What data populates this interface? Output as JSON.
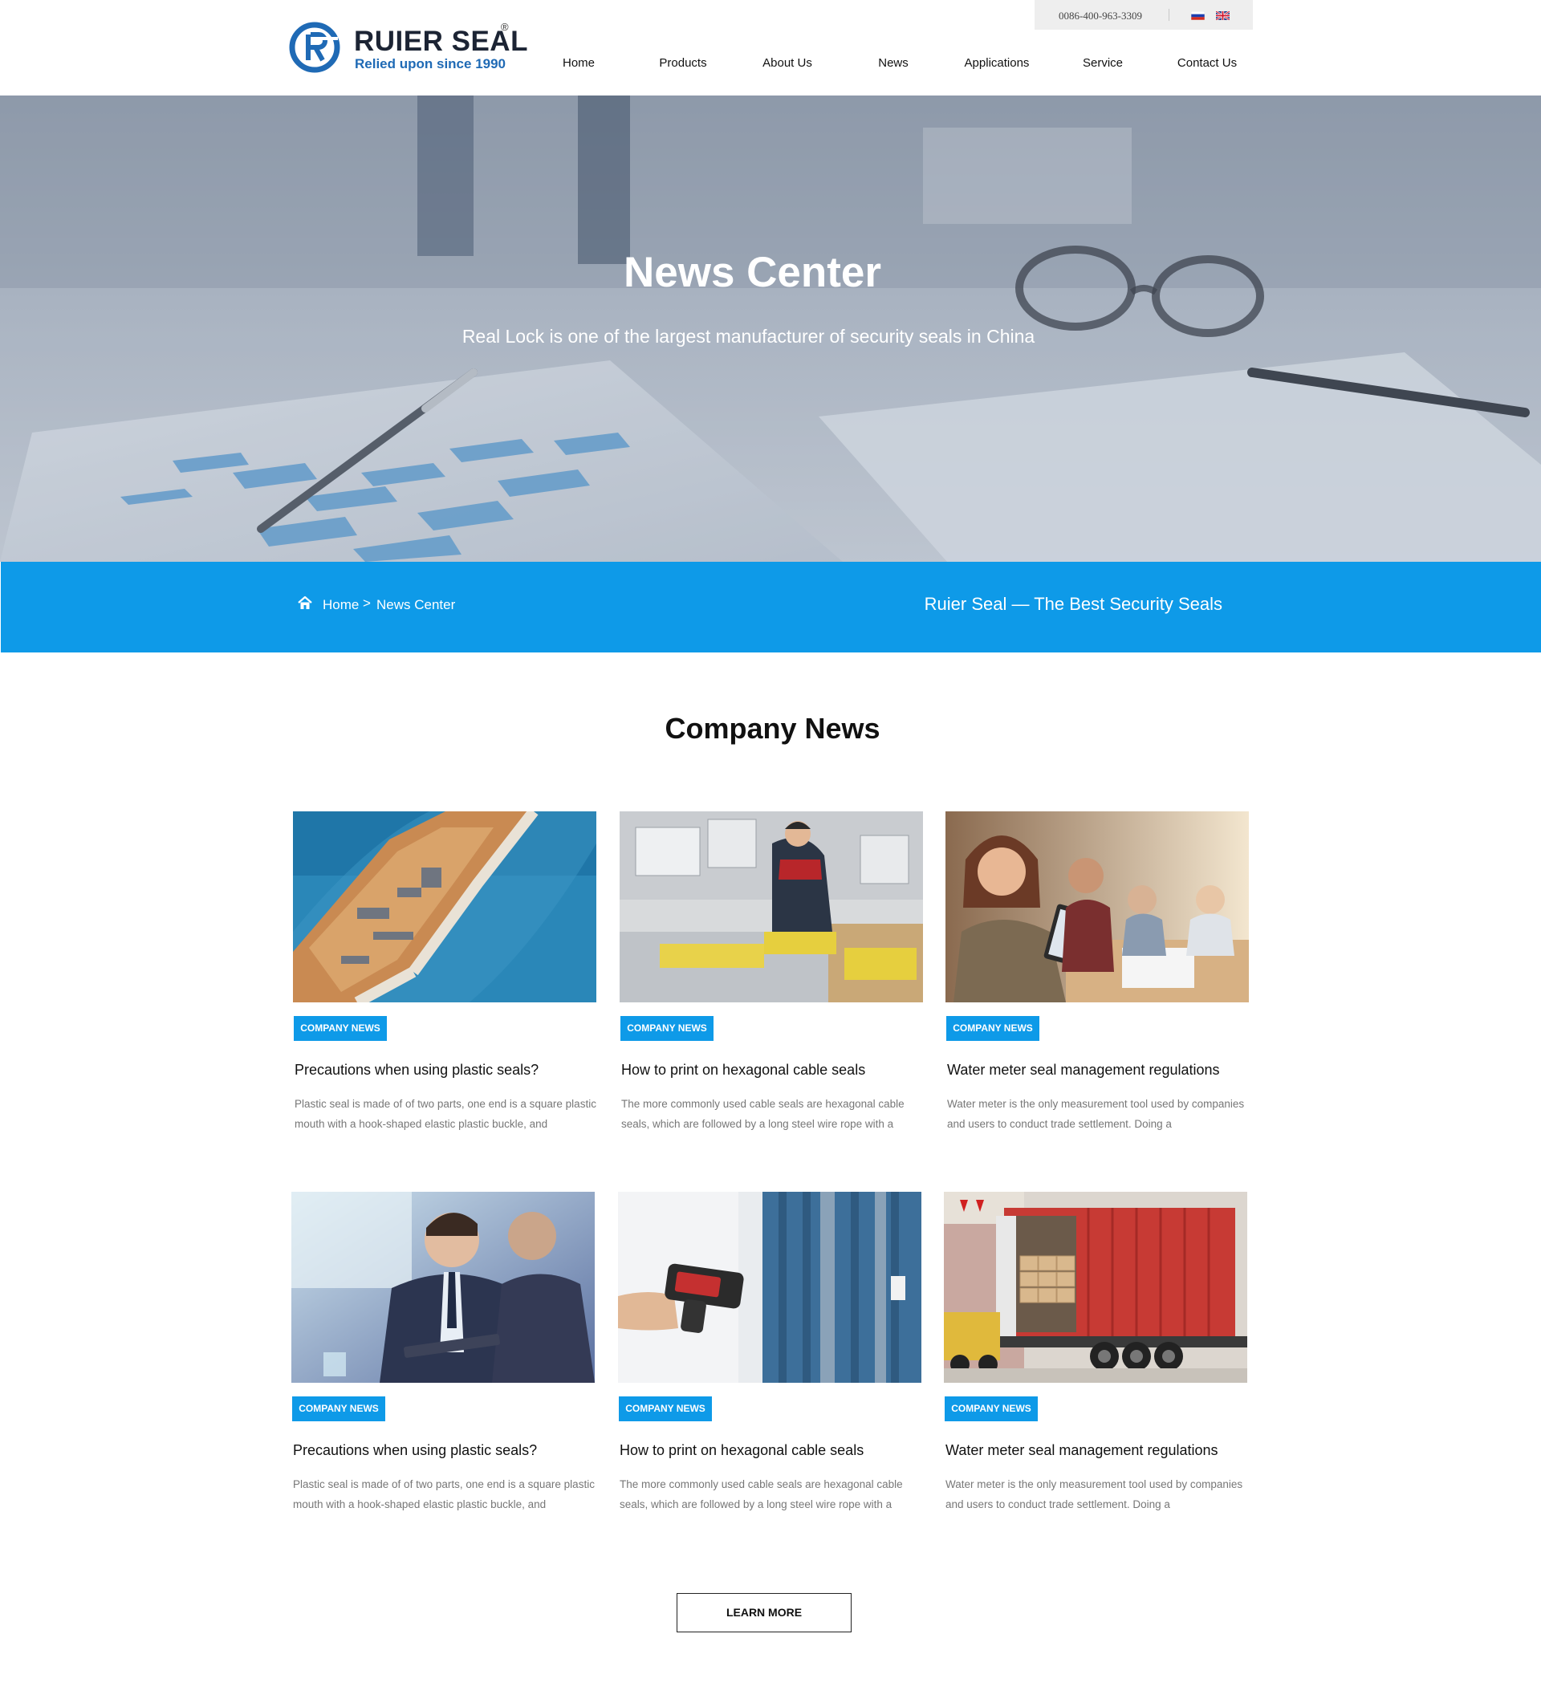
{
  "brand": {
    "name": "RUIER SEAL",
    "registered": "®",
    "tagline": "Relied upon since 1990",
    "color": "#1f6ab5"
  },
  "topbar": {
    "phone": "0086-400-963-3309",
    "languages": [
      "russian-flag-icon",
      "english-flag-icon"
    ]
  },
  "nav": [
    "Home",
    "Products",
    "About Us",
    "News",
    "Applications",
    "Service",
    "Contact Us"
  ],
  "banner": {
    "title": "News Center",
    "subtitle": "Real Lock is one of the largest manufacturer of security seals in China"
  },
  "breadcrumb": {
    "icon": "home-icon",
    "home": "Home",
    "separator": ">",
    "current": "News Center",
    "slogan": "Ruier Seal — The Best  Security Seals",
    "color": "#0e9ae8"
  },
  "section": {
    "title": "Company News"
  },
  "cards": [
    {
      "tag": "COMPANY NEWS",
      "title": "Precautions when using plastic seals?",
      "desc": "Plastic seal is made of of two parts, one end is a square plastic mouth with a hook-shaped elastic plastic buckle, and"
    },
    {
      "tag": "COMPANY NEWS",
      "title": "How to print on hexagonal cable seals",
      "desc": "The more commonly used cable seals are hexagonal cable seals, which are followed by a long steel wire rope with a"
    },
    {
      "tag": "COMPANY NEWS",
      "title": "Water meter seal management regulations",
      "desc": "Water meter is the only measurement tool used by companies and users to conduct trade settlement. Doing a"
    },
    {
      "tag": "COMPANY NEWS",
      "title": "Precautions when using plastic seals?",
      "desc": "Plastic seal is made of of two parts, one end is a square plastic mouth with a hook-shaped elastic plastic buckle, and"
    },
    {
      "tag": "COMPANY NEWS",
      "title": "How to print on hexagonal cable seals",
      "desc": "The more commonly used cable seals are hexagonal cable seals, which are followed by a long steel wire rope with a"
    },
    {
      "tag": "COMPANY NEWS",
      "title": "Water meter seal management regulations",
      "desc": "Water meter is the only measurement tool used by companies and users to conduct trade settlement. Doing a"
    }
  ],
  "more_button": "LEARN MORE",
  "colors": {
    "accent": "#0e9ae8",
    "text": "#111111",
    "muted": "#777777"
  }
}
